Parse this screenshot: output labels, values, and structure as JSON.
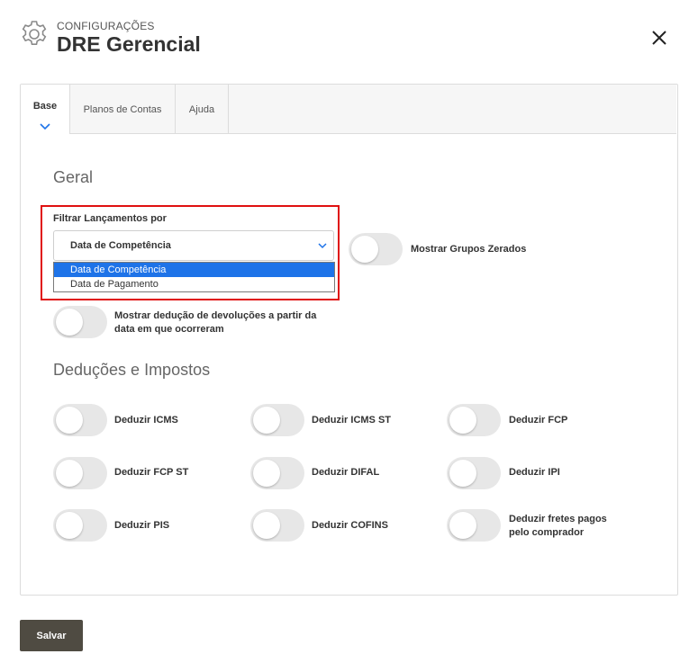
{
  "header": {
    "subtitle": "CONFIGURAÇÕES",
    "title": "DRE Gerencial",
    "settings_icon": "gear-icon",
    "close_icon": "close-icon"
  },
  "tabs": [
    {
      "label": "Base",
      "active": true
    },
    {
      "label": "Planos de Contas",
      "active": false
    },
    {
      "label": "Ajuda",
      "active": false
    }
  ],
  "geral": {
    "section_title": "Geral",
    "filter": {
      "label": "Filtrar Lançamentos por",
      "selected": "Data de Competência",
      "options": [
        "Data de Competência",
        "Data de Pagamento"
      ]
    },
    "toggles": {
      "mostrar_grupos_zerados": {
        "label": "Mostrar Grupos Zerados",
        "on": false
      },
      "mostrar_deducao_devolucoes": {
        "label_line1": "Mostrar dedução de devoluções a partir da",
        "label_line2": "data em que ocorreram",
        "on": false
      }
    }
  },
  "deducoes": {
    "section_title": "Deduções e Impostos",
    "toggles": [
      {
        "label": "Deduzir ICMS",
        "on": false
      },
      {
        "label": "Deduzir ICMS ST",
        "on": false
      },
      {
        "label": "Deduzir FCP",
        "on": false
      },
      {
        "label": "Deduzir FCP ST",
        "on": false
      },
      {
        "label": "Deduzir DIFAL",
        "on": false
      },
      {
        "label": "Deduzir IPI",
        "on": false
      },
      {
        "label": "Deduzir PIS",
        "on": false
      },
      {
        "label": "Deduzir COFINS",
        "on": false
      },
      {
        "label_line1": "Deduzir fretes pagos",
        "label_line2": "pelo comprador",
        "on": false
      }
    ]
  },
  "footer": {
    "save_label": "Salvar"
  },
  "colors": {
    "accent": "#1e73e8",
    "highlight_border": "#e01010",
    "save_button": "#4f4b42",
    "toggle_off": "#e7e7e7"
  }
}
